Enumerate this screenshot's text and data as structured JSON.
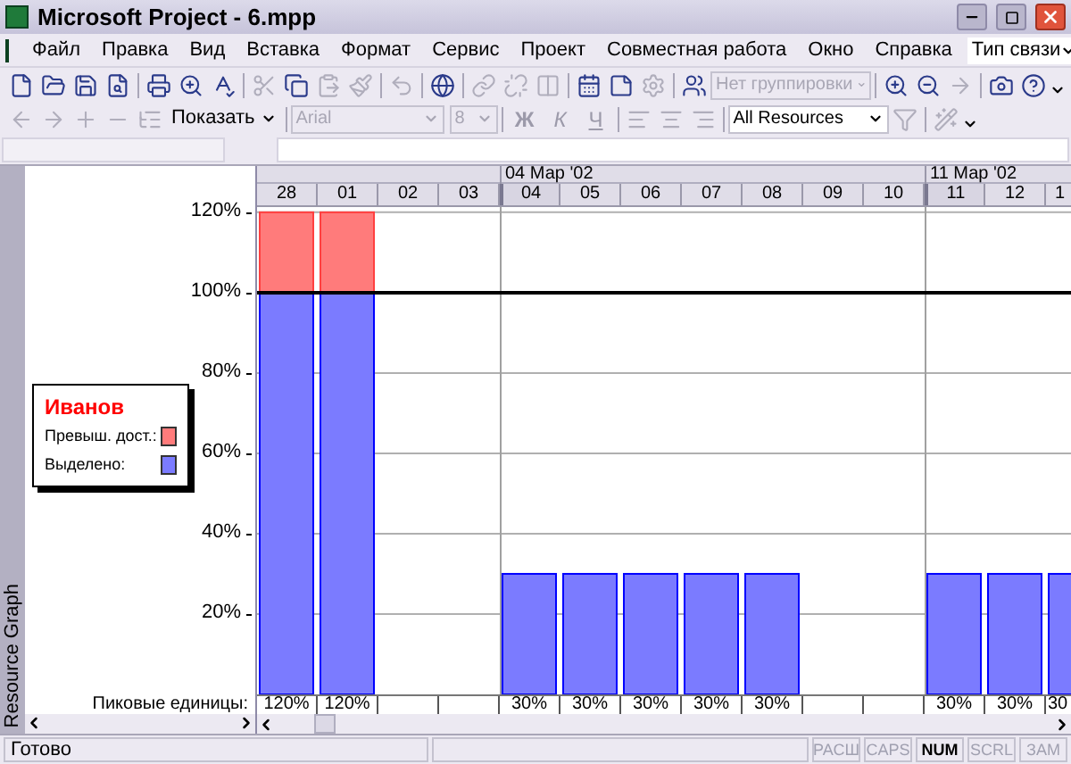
{
  "window": {
    "title": "Microsoft Project - 6.mpp"
  },
  "menu": [
    "Файл",
    "Правка",
    "Вид",
    "Вставка",
    "Формат",
    "Сервис",
    "Проект",
    "Совместная работа",
    "Окно",
    "Справка"
  ],
  "help_box": {
    "value": "Тип связи"
  },
  "toolbar": {
    "group_by": {
      "value": "Нет группировки",
      "disabled": true
    },
    "show_button": "Показать",
    "font": {
      "value": "Arial",
      "disabled": true
    },
    "font_size": {
      "value": "8",
      "disabled": true
    },
    "format_buttons": [
      {
        "label": "Ж",
        "kind": "bold",
        "disabled": true
      },
      {
        "label": "К",
        "kind": "italic",
        "disabled": true
      },
      {
        "label": "Ч",
        "kind": "underline",
        "disabled": true
      }
    ],
    "filter": {
      "value": "All Resources"
    }
  },
  "side_label": "Resource Graph",
  "legend": {
    "title": "Иванов"
  },
  "peak_label": "Пиковые единицы:",
  "columns": [
    {
      "week_start": false,
      "peak": "120%"
    },
    {
      "week_start": false,
      "peak": "120%"
    },
    {
      "week_start": false
    },
    {
      "week_start": false
    },
    {
      "week_start": true,
      "week": "04 Мар '02",
      "peak": "30%"
    },
    {
      "week_start": false,
      "peak": "30%"
    },
    {
      "week_start": false,
      "peak": "30%"
    },
    {
      "week_start": false,
      "peak": "30%"
    },
    {
      "week_start": false,
      "peak": "30%"
    },
    {
      "week_start": false
    },
    {
      "week_start": false
    },
    {
      "week_start": true,
      "week": "11 Мар '02",
      "peak": "30%"
    },
    {
      "week_start": false,
      "peak": "30%"
    },
    {
      "week_start": false,
      "peak": "30"
    }
  ],
  "chart_data": {
    "type": "bar",
    "stacked": true,
    "categories": [
      "28",
      "01",
      "02",
      "03",
      "04",
      "05",
      "06",
      "07",
      "08",
      "09",
      "10",
      "11",
      "12",
      "1"
    ],
    "series": [
      {
        "name": "Выделено:",
        "color": "#7b7bff",
        "values": [
          100,
          100,
          0,
          0,
          30,
          30,
          30,
          30,
          30,
          0,
          0,
          30,
          30,
          30
        ]
      },
      {
        "name": "Превыш. дост.:",
        "color": "#ff7b7b",
        "values": [
          20,
          20,
          0,
          0,
          0,
          0,
          0,
          0,
          0,
          0,
          0,
          0,
          0,
          0
        ]
      }
    ],
    "ylim": [
      0,
      121.3
    ],
    "yticks": [
      {
        "value": 20,
        "label": "20%"
      },
      {
        "value": 40,
        "label": "40%"
      },
      {
        "value": 60,
        "label": "60%"
      },
      {
        "value": 80,
        "label": "80%"
      },
      {
        "value": 100,
        "label": "100%"
      },
      {
        "value": 120,
        "label": "120%"
      }
    ],
    "ref_lines": [
      {
        "axis": "y",
        "value": 100
      }
    ],
    "grid": true,
    "legend": "left"
  },
  "status_bar": {
    "text": "Готово",
    "indicators": [
      {
        "label": "РАСШ",
        "on": false
      },
      {
        "label": "CAPS",
        "on": false
      },
      {
        "label": "NUM",
        "on": true
      },
      {
        "label": "SCRL",
        "on": false
      },
      {
        "label": "ЗАМ",
        "on": false
      }
    ]
  }
}
